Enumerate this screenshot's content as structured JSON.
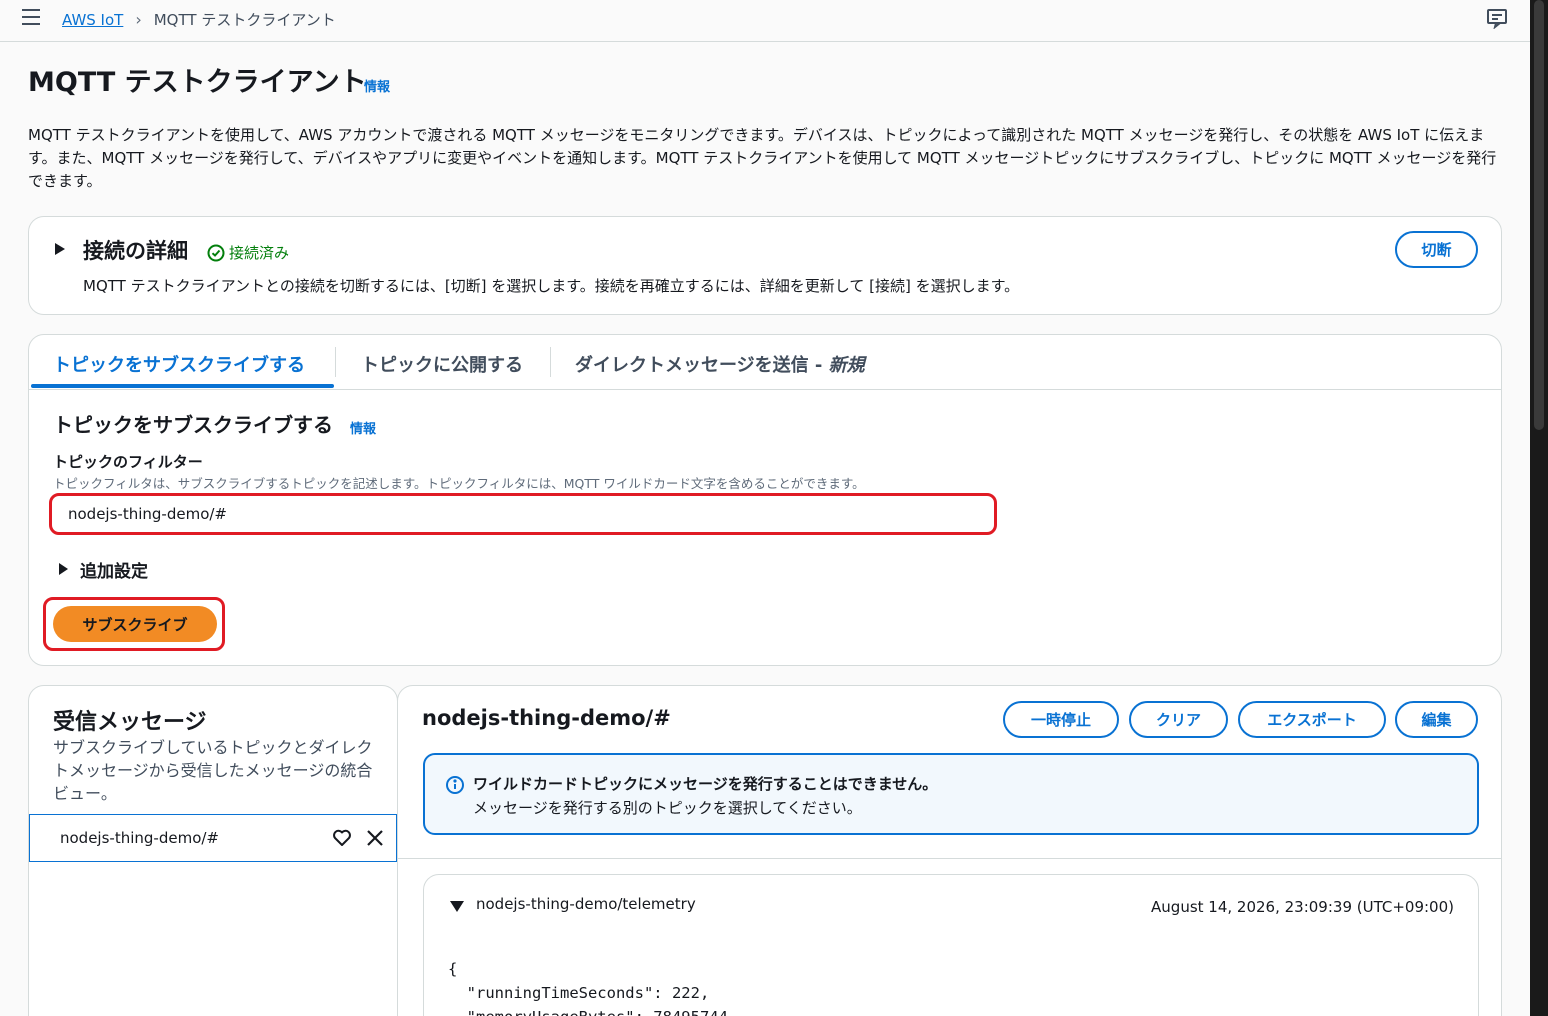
{
  "breadcrumb": {
    "root": "AWS IoT",
    "current": "MQTT テストクライアント"
  },
  "page": {
    "title": "MQTT テストクライアント",
    "info": "情報",
    "description": "MQTT テストクライアントを使用して、AWS アカウントで渡される MQTT メッセージをモニタリングできます。デバイスは、トピックによって識別された MQTT メッセージを発行し、その状態を AWS IoT に伝えます。また、MQTT メッセージを発行して、デバイスやアプリに変更やイベントを通知します。MQTT テストクライアントを使用して MQTT メッセージトピックにサブスクライブし、トピックに MQTT メッセージを発行できます。"
  },
  "connection": {
    "title": "接続の詳細",
    "status": "接続済み",
    "description": "MQTT テストクライアントとの接続を切断するには、[切断] を選択します。接続を再確立するには、詳細を更新して [接続] を選択します。",
    "disconnect_label": "切断"
  },
  "tabs": [
    {
      "label": "トピックをサブスクライブする"
    },
    {
      "label": "トピックに公開する"
    },
    {
      "label": "ダイレクトメッセージを送信 - ",
      "suffix": "新規"
    }
  ],
  "subscribe": {
    "title": "トピックをサブスクライブする",
    "info": "情報",
    "filter_label": "トピックのフィルター",
    "filter_hint": "トピックフィルタは、サブスクライブするトピックを記述します。トピックフィルタには、MQTT ワイルドカード文字を含めることができます。",
    "filter_value": "nodejs-thing-demo/#",
    "extra_settings": "追加設定",
    "subscribe_label": "サブスクライブ"
  },
  "inbox": {
    "title": "受信メッセージ",
    "description": "サブスクライブしているトピックとダイレクトメッセージから受信したメッセージの統合ビュー。",
    "items": [
      {
        "label": "nodejs-thing-demo/#"
      }
    ]
  },
  "messages": {
    "title": "nodejs-thing-demo/#",
    "pause_label": "一時停止",
    "clear_label": "クリア",
    "export_label": "エクスポート",
    "edit_label": "編集",
    "alert_title": "ワイルドカードトピックにメッセージを発行することはできません。",
    "alert_body": "メッセージを発行する別のトピックを選択してください。",
    "entry": {
      "topic": "nodejs-thing-demo/telemetry",
      "timestamp": "August 14, 2026, 23:09:39 (UTC+09:00)",
      "payload": "{\n  \"runningTimeSeconds\": 222,\n  \"memoryUsageBytes\": 78495744"
    }
  },
  "colors": {
    "accent": "#0972d3",
    "primary_button": "#f28b24",
    "highlight_outline": "#e01b24",
    "success": "#037f0c"
  }
}
